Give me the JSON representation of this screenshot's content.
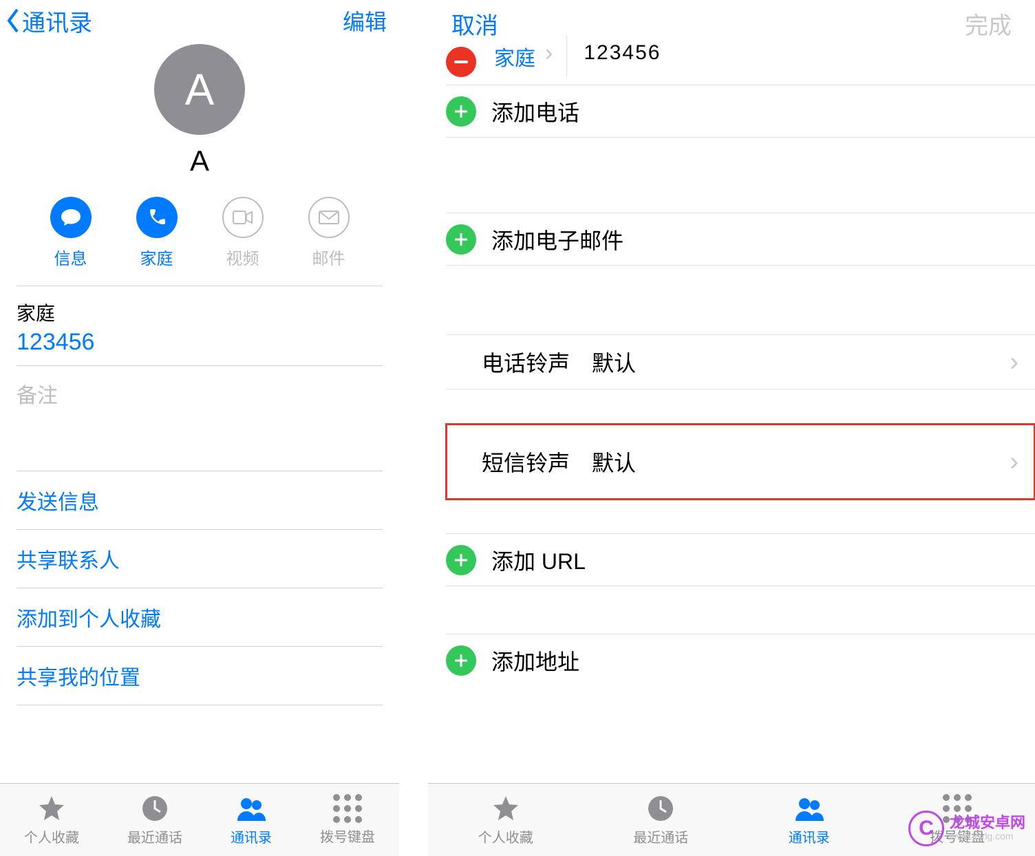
{
  "left": {
    "nav": {
      "back_label": "通讯录",
      "edit_label": "编辑"
    },
    "contact": {
      "avatar_initial": "A",
      "name": "A"
    },
    "actions": {
      "message": "信息",
      "call": "家庭",
      "video": "视频",
      "mail": "邮件"
    },
    "phone": {
      "label": "家庭",
      "number": "123456"
    },
    "notes_placeholder": "备注",
    "links": {
      "send_message": "发送信息",
      "share_contact": "共享联系人",
      "add_favorite": "添加到个人收藏",
      "share_location": "共享我的位置"
    },
    "tabs": {
      "favorites": "个人收藏",
      "recents": "最近通话",
      "contacts": "通讯录",
      "keypad": "拨号键盘"
    }
  },
  "right": {
    "nav": {
      "cancel_label": "取消",
      "done_label": "完成"
    },
    "partial_phone": {
      "label": "家庭",
      "number": "123456"
    },
    "add_phone": "添加电话",
    "add_email": "添加电子邮件",
    "ringtone": {
      "key": "电话铃声",
      "value": "默认"
    },
    "texttone": {
      "key": "短信铃声",
      "value": "默认"
    },
    "add_url": "添加 URL",
    "add_address": "添加地址",
    "tabs": {
      "favorites": "个人收藏",
      "recents": "最近通话",
      "contacts": "通讯录",
      "keypad": "拨号键盘"
    }
  },
  "watermark": {
    "brand": "龙城安卓网",
    "url": "www.lcjrlg.com"
  }
}
